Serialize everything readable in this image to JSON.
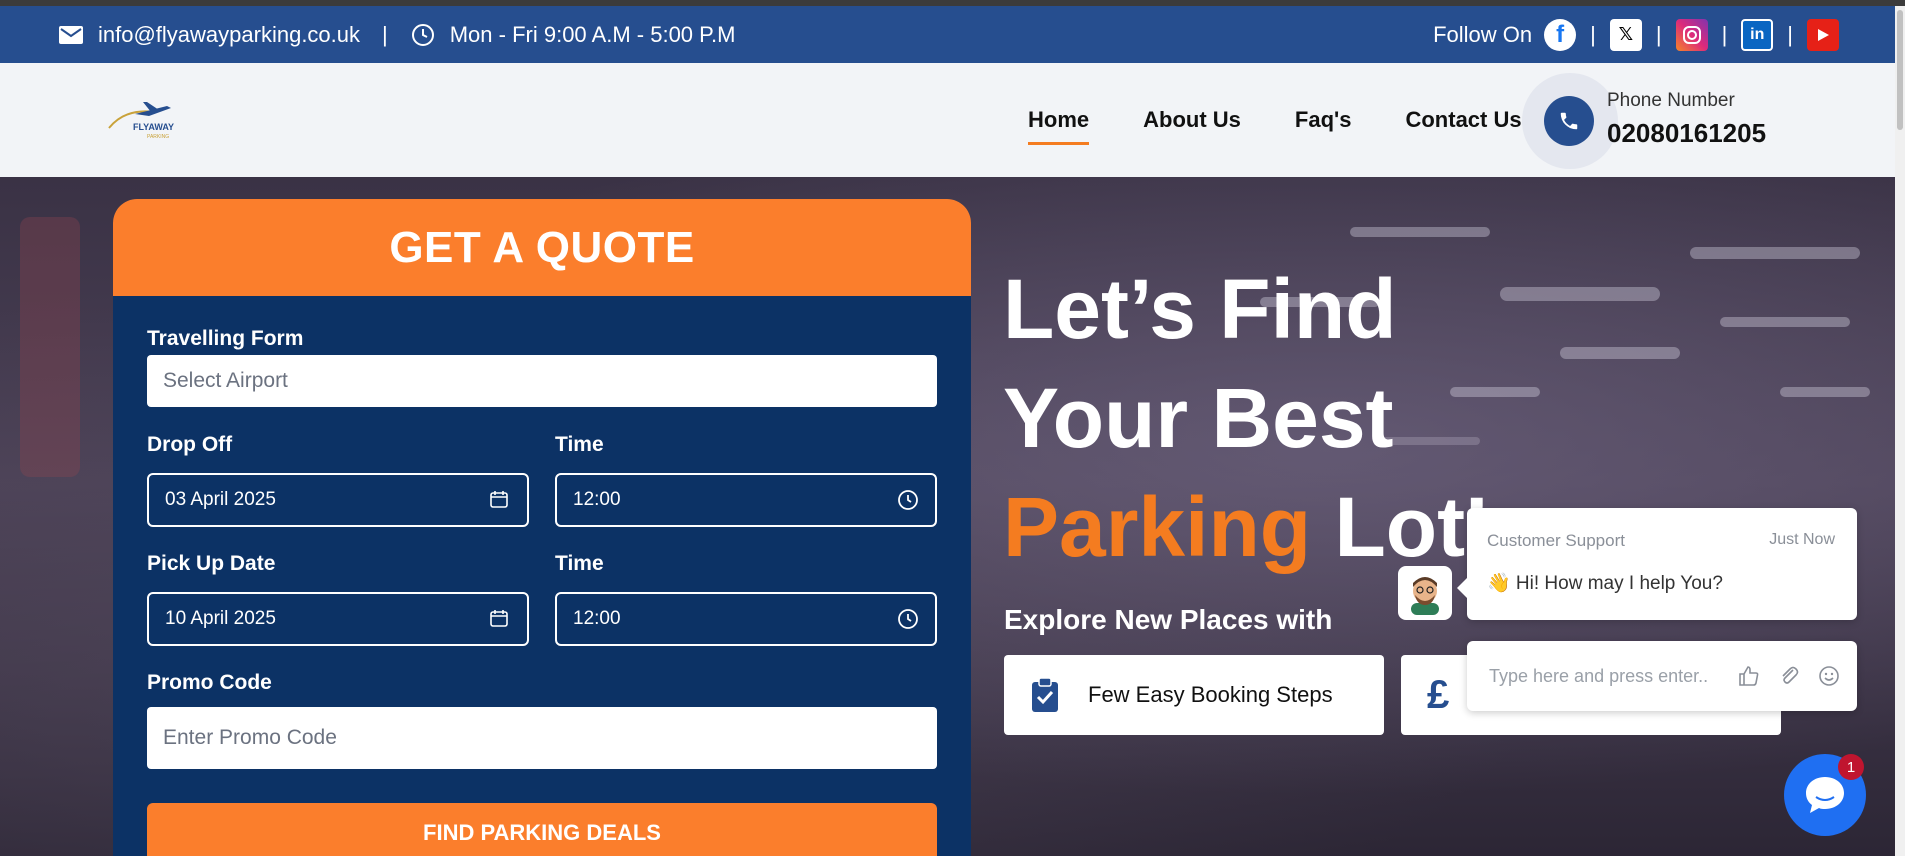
{
  "topbar": {
    "email": "info@flyawayparking.co.uk",
    "separator": "|",
    "hours": "Mon - Fri 9:00 A.M - 5:00 P.M",
    "follow_label": "Follow On",
    "socials": [
      "facebook",
      "x",
      "instagram",
      "linkedin",
      "youtube"
    ]
  },
  "brand": {
    "logo_text": "FLYAWAY",
    "logo_sub": "PARKING"
  },
  "nav": {
    "items": [
      {
        "label": "Home",
        "active": true
      },
      {
        "label": "About Us"
      },
      {
        "label": "Faq's"
      },
      {
        "label": "Contact Us"
      }
    ],
    "phone_label": "Phone Number",
    "phone_number": "02080161205"
  },
  "quote": {
    "title": "GET A QUOTE",
    "travelling_label": "Travelling Form",
    "airport_placeholder": "Select Airport",
    "dropoff_label": "Drop Off",
    "dropoff_date": "03 April 2025",
    "dropoff_time_label": "Time",
    "dropoff_time": "12:00",
    "pickup_label": "Pick Up Date",
    "pickup_date": "10 April 2025",
    "pickup_time_label": "Time",
    "pickup_time": "12:00",
    "promo_label": "Promo Code",
    "promo_placeholder": "Enter Promo Code",
    "submit": "FIND PARKING DEALS"
  },
  "hero": {
    "line1": "Let’s Find",
    "line2": "Your Best",
    "line3_highlight": "Parking",
    "line3_rest": " Lot’",
    "explore": "Explore New Places with",
    "feature1": "Few Easy Booking Steps",
    "feature2_symbol": "£"
  },
  "chat": {
    "agent": "Customer Support",
    "time": "Just Now",
    "message": "👋 Hi! How may I help You?",
    "input_placeholder": "Type here and press enter..",
    "unread": "1"
  },
  "colors": {
    "primary": "#264e8f",
    "accent": "#f47c20",
    "form_bg": "#0c3265"
  }
}
